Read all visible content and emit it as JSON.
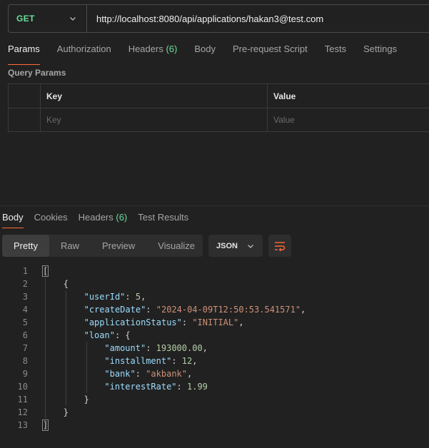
{
  "request": {
    "method": "GET",
    "url": "http://localhost:8080/api/applications/hakan3@test.com"
  },
  "request_tabs": [
    {
      "label": "Params",
      "active": true
    },
    {
      "label": "Authorization"
    },
    {
      "label": "Headers",
      "count": "(6)"
    },
    {
      "label": "Body"
    },
    {
      "label": "Pre-request Script"
    },
    {
      "label": "Tests"
    },
    {
      "label": "Settings"
    }
  ],
  "query_params": {
    "title": "Query Params",
    "columns": {
      "key": "Key",
      "value": "Value"
    },
    "placeholders": {
      "key": "Key",
      "value": "Value"
    }
  },
  "response_tabs": [
    {
      "label": "Body",
      "active": true
    },
    {
      "label": "Cookies"
    },
    {
      "label": "Headers",
      "count": "(6)"
    },
    {
      "label": "Test Results"
    }
  ],
  "view_modes": [
    {
      "label": "Pretty",
      "active": true
    },
    {
      "label": "Raw"
    },
    {
      "label": "Preview"
    },
    {
      "label": "Visualize"
    }
  ],
  "format": "JSON",
  "icons": {
    "chevron": "chevron-down-icon",
    "wrap": "wrap-lines-icon"
  },
  "colors": {
    "accent": "#ff6c37",
    "method_get": "#6bdd9a",
    "key": "#9cdcfe",
    "string": "#ce9178",
    "number": "#b5cea8"
  },
  "response_body": {
    "line_numbers": [
      "1",
      "2",
      "3",
      "4",
      "5",
      "6",
      "7",
      "8",
      "9",
      "10",
      "11",
      "12",
      "13"
    ],
    "lines": [
      [
        {
          "t": "p",
          "v": "["
        }
      ],
      [
        {
          "t": "p",
          "v": "{"
        }
      ],
      [
        {
          "t": "k",
          "v": "\"userId\""
        },
        {
          "t": "p",
          "v": ": "
        },
        {
          "t": "n",
          "v": "5"
        },
        {
          "t": "p",
          "v": ","
        }
      ],
      [
        {
          "t": "k",
          "v": "\"createDate\""
        },
        {
          "t": "p",
          "v": ": "
        },
        {
          "t": "s",
          "v": "\"2024-04-09T12:50:53.541571\""
        },
        {
          "t": "p",
          "v": ","
        }
      ],
      [
        {
          "t": "k",
          "v": "\"applicationStatus\""
        },
        {
          "t": "p",
          "v": ": "
        },
        {
          "t": "s",
          "v": "\"INITIAL\""
        },
        {
          "t": "p",
          "v": ","
        }
      ],
      [
        {
          "t": "k",
          "v": "\"loan\""
        },
        {
          "t": "p",
          "v": ": {"
        }
      ],
      [
        {
          "t": "k",
          "v": "\"amount\""
        },
        {
          "t": "p",
          "v": ": "
        },
        {
          "t": "n",
          "v": "193000.00"
        },
        {
          "t": "p",
          "v": ","
        }
      ],
      [
        {
          "t": "k",
          "v": "\"installment\""
        },
        {
          "t": "p",
          "v": ": "
        },
        {
          "t": "n",
          "v": "12"
        },
        {
          "t": "p",
          "v": ","
        }
      ],
      [
        {
          "t": "k",
          "v": "\"bank\""
        },
        {
          "t": "p",
          "v": ": "
        },
        {
          "t": "s",
          "v": "\"akbank\""
        },
        {
          "t": "p",
          "v": ","
        }
      ],
      [
        {
          "t": "k",
          "v": "\"interestRate\""
        },
        {
          "t": "p",
          "v": ": "
        },
        {
          "t": "n",
          "v": "1.99"
        }
      ],
      [
        {
          "t": "p",
          "v": "}"
        }
      ],
      [
        {
          "t": "p",
          "v": "}"
        }
      ],
      [
        {
          "t": "p",
          "v": "]"
        }
      ]
    ]
  }
}
